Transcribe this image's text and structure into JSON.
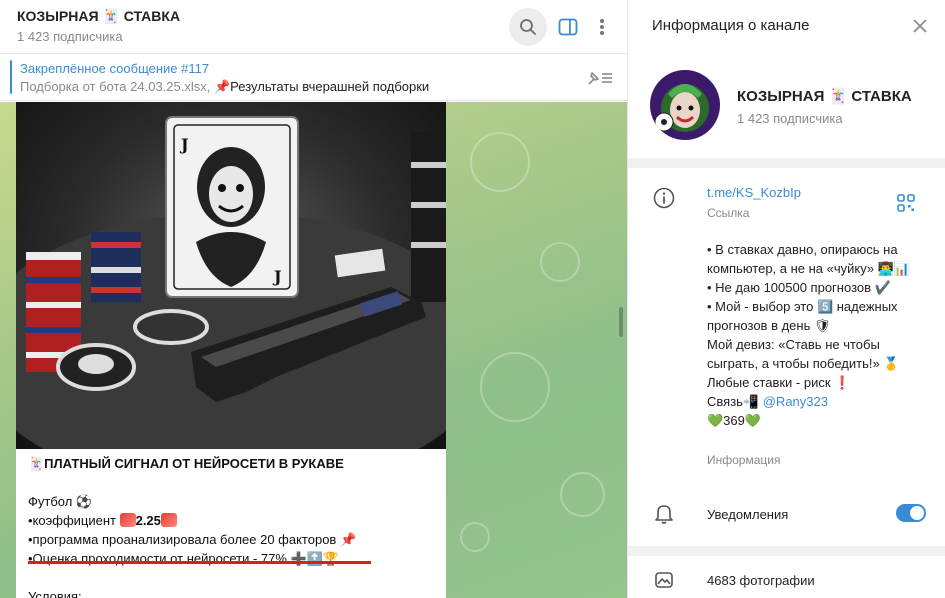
{
  "chat": {
    "title": "КОЗЫРНАЯ 🃏 СТАВКА",
    "subscribers": "1 423 подписчика"
  },
  "pinned": {
    "title": "Закреплённое сообщение #117",
    "text_gray": "Подборка от бота 24.03.25.xlsx, ",
    "text_main": "📌Результаты вчерашней подборки"
  },
  "message": {
    "heading": "🃏ПЛАТНЫЙ СИГНАЛ ОТ НЕЙРОСЕТИ В РУКАВЕ",
    "sport": "Футбол ⚽",
    "line_coef_label": "•коэффициент ",
    "line_coef_value": "2.25",
    "line_factors": "•программа проанализировала более 20 факторов 📌",
    "line_rate": "•Оценка проходимости от нейросети - 77% ➕🔝🏆",
    "conditions": "Условия:"
  },
  "info": {
    "title": "Информация о канале",
    "name": "КОЗЫРНАЯ 🃏 СТАВКА",
    "subscribers": "1 423 подписчика",
    "link": "t.me/KS_KozbIp",
    "link_caption": "Ссылка",
    "about_lines": {
      "l1": "• В ставках давно, опираюсь на компьютер, а не на «чуйку» 👨‍💻📊",
      "l2": "• Не даю 100500 прогнозов ✔️",
      "l3": "• Мой - выбор это 5️⃣ надежных прогнозов в день 🛡",
      "l4": "Мой девиз: «Ставь не чтобы сыграть, а чтобы победить!» 🥇",
      "l5": "Любые ставки - риск ❗",
      "l6_prefix": "Связь📲 ",
      "l6_user": "@Rany323",
      "l7": "💚369💚"
    },
    "about_caption": "Информация",
    "notifications_label": "Уведомления",
    "notifications_on": true,
    "photos": "4683 фотографии"
  },
  "colors": {
    "accent": "#3a8bd6",
    "chat_bg": "#9fc78a",
    "underline": "#d81e1e"
  },
  "icons": [
    "search-icon",
    "sidebar-panel-icon",
    "more-vertical-icon",
    "pin-list-icon",
    "close-icon",
    "info-icon",
    "qr-code-icon",
    "bell-icon",
    "photos-icon"
  ]
}
